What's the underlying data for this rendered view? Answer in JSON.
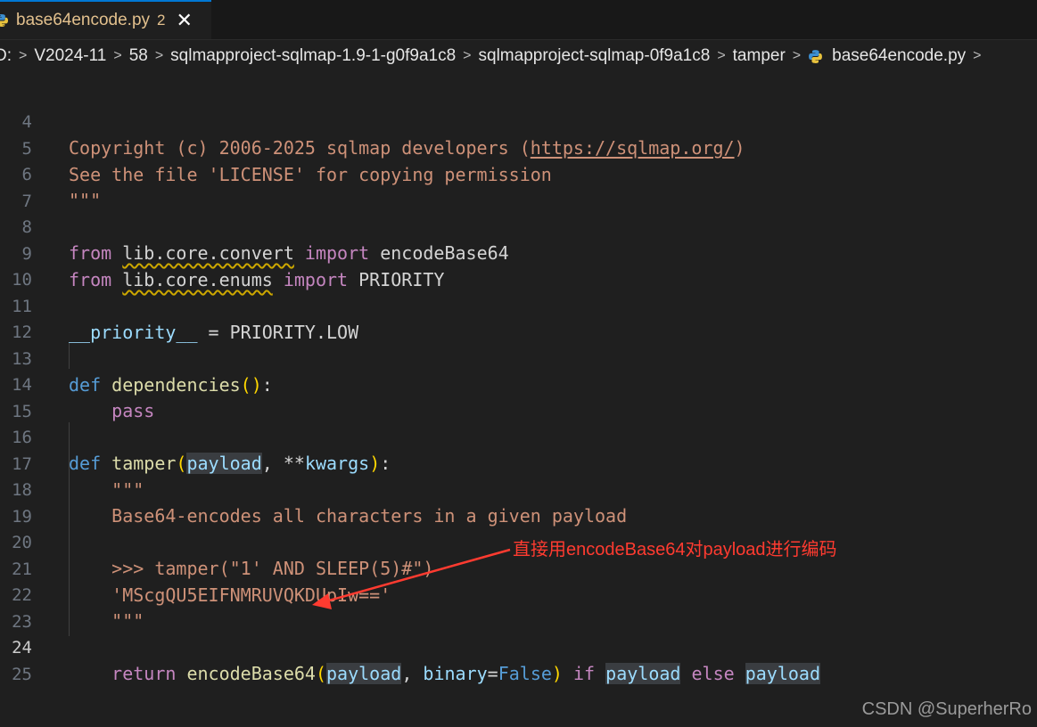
{
  "tab": {
    "filename": "base64encode.py",
    "problems": "2",
    "close": "✕"
  },
  "breadcrumb": [
    "D:",
    "V2024-11",
    "58",
    "sqlmapproject-sqlmap-1.9-1-g0f9a1c8",
    "sqlmapproject-sqlmap-0f9a1c8",
    "tamper",
    "base64encode.py"
  ],
  "editor": {
    "active_line": "24",
    "lines": [
      {
        "n": "4",
        "code": "Copyright (c) 2006-2025 sqlmap developers (https://sqlmap.org/)"
      },
      {
        "n": "5",
        "code": "See the file 'LICENSE' for copying permission"
      },
      {
        "n": "6",
        "code": "\"\"\""
      },
      {
        "n": "7",
        "code": ""
      },
      {
        "n": "8",
        "code": "from lib.core.convert import encodeBase64"
      },
      {
        "n": "9",
        "code": "from lib.core.enums import PRIORITY"
      },
      {
        "n": "10",
        "code": ""
      },
      {
        "n": "11",
        "code": "__priority__ = PRIORITY.LOW"
      },
      {
        "n": "12",
        "code": ""
      },
      {
        "n": "13",
        "code": "def dependencies():"
      },
      {
        "n": "14",
        "code": "    pass"
      },
      {
        "n": "15",
        "code": ""
      },
      {
        "n": "16",
        "code": "def tamper(payload, **kwargs):"
      },
      {
        "n": "17",
        "code": "    \"\"\""
      },
      {
        "n": "18",
        "code": "    Base64-encodes all characters in a given payload"
      },
      {
        "n": "19",
        "code": ""
      },
      {
        "n": "20",
        "code": "    >>> tamper(\"1' AND SLEEP(5)#\")"
      },
      {
        "n": "21",
        "code": "    'MScgQU5EIFNMRUVQKDUpIw=='"
      },
      {
        "n": "22",
        "code": "    \"\"\""
      },
      {
        "n": "23",
        "code": ""
      },
      {
        "n": "24",
        "code": "    return encodeBase64(payload, binary=False) if payload else payload"
      },
      {
        "n": "25",
        "code": ""
      }
    ]
  },
  "annotation": "直接用encodeBase64对payload进行编码",
  "watermark": "CSDN @SuperherRo",
  "colors": {
    "annotation": "#ff3b30",
    "tab_accent": "#0078d4"
  },
  "icons": {
    "file": "python-icon",
    "close": "close-icon",
    "separator": "chevron-right-icon"
  }
}
